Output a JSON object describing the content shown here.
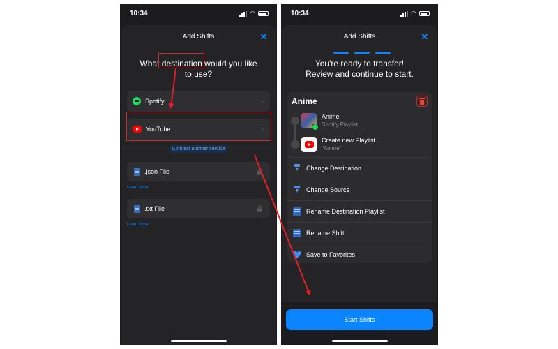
{
  "status": {
    "time": "10:34"
  },
  "left_screen": {
    "sheet_title": "Add Shifts",
    "question": [
      "What destination would you like",
      "to use?"
    ],
    "services": [
      {
        "label": "Spotify",
        "icon": "spotify-icon"
      },
      {
        "label": "YouTube",
        "icon": "youtube-icon"
      }
    ],
    "connect_label": "Connect another service",
    "files": [
      {
        "label": ".json File",
        "learn_more": "Learn More"
      },
      {
        "label": ".txt File",
        "learn_more": "Learn More"
      }
    ]
  },
  "right_screen": {
    "sheet_title": "Add Shifts",
    "heading": [
      "You're ready to transfer!",
      "Review and continue to start."
    ],
    "card": {
      "title": "Anime",
      "source": {
        "name": "Anime",
        "subtitle": "Spotify Playlist"
      },
      "destination": {
        "name": "Create new Playlist",
        "subtitle": "\"Anime\""
      },
      "actions": [
        {
          "label": "Change Destination",
          "icon": "change-destination-icon"
        },
        {
          "label": "Change Source",
          "icon": "change-source-icon"
        },
        {
          "label": "Rename Destination Playlist",
          "icon": "rename-playlist-icon"
        },
        {
          "label": "Rename Shift",
          "icon": "rename-shift-icon"
        },
        {
          "label": "Save to Favorites",
          "icon": "heart-icon"
        }
      ]
    },
    "start_button": "Start Shifts"
  },
  "colors": {
    "accent": "#0a84ff",
    "annotation_red": "#e32027",
    "spotify_green": "#1ed760",
    "youtube_red": "#ff0000",
    "sheet_background": "#242426"
  }
}
